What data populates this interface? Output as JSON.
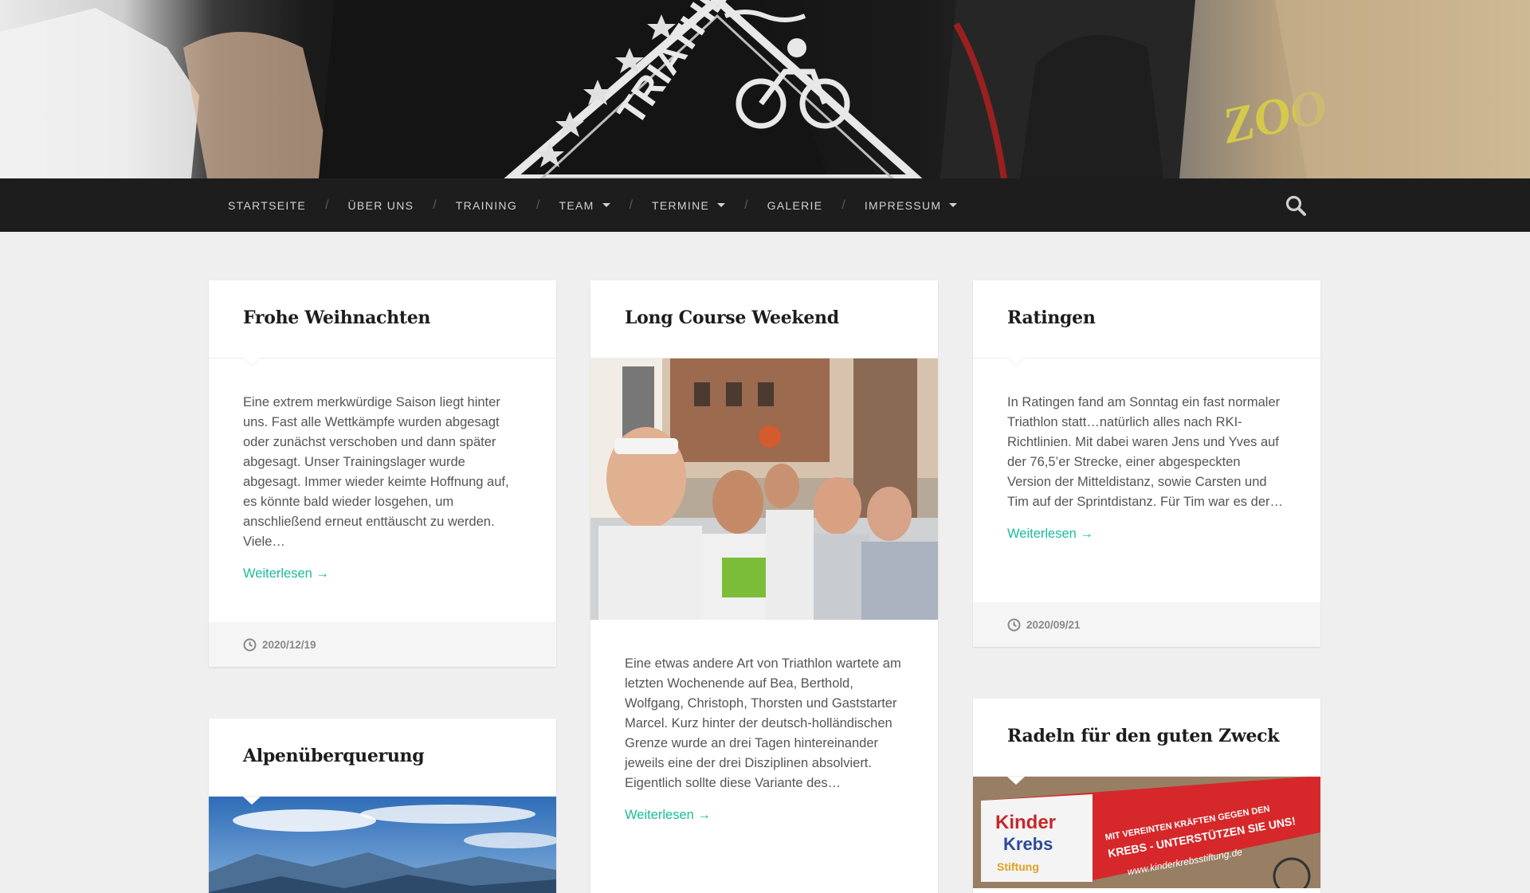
{
  "nav": {
    "items": [
      {
        "label": "Startseite",
        "dropdown": false
      },
      {
        "label": "Über uns",
        "dropdown": false
      },
      {
        "label": "Training",
        "dropdown": false
      },
      {
        "label": "Team",
        "dropdown": true
      },
      {
        "label": "Termine",
        "dropdown": true
      },
      {
        "label": "Galerie",
        "dropdown": false
      },
      {
        "label": "Impressum",
        "dropdown": true
      }
    ],
    "separator": "/",
    "search_icon": "search-icon"
  },
  "colors": {
    "accent": "#1abc9c",
    "navbar": "#1d1d1d",
    "page_bg": "#efefef"
  },
  "posts": [
    {
      "title": "Frohe Weihnachten",
      "excerpt": "Eine extrem merkwürdige Saison liegt hinter uns. Fast alle Wettkämpfe wurden abgesagt oder zunächst verschoben und dann später abgesagt. Unser Trainingslager wurde abgesagt. Immer wieder keimte Hoffnung auf, es könnte bald wieder losgehen, um anschließend erneut enttäuscht zu werden. Viele…",
      "more": "Weiterlesen →",
      "date": "2020/12/19"
    },
    {
      "title": "Long Course Weekend",
      "excerpt": "Eine etwas andere Art von Triathlon wartete am letzten Wochenende auf Bea, Berthold, Wolfgang, Christoph, Thorsten und Gaststarter Marcel. Kurz hinter der deutsch-holländischen Grenze wurde an drei Tagen hintereinander jeweils eine der drei Disziplinen absolviert. Eigentlich sollte diese Variante des…",
      "more": "Weiterlesen →"
    },
    {
      "title": "Ratingen",
      "excerpt": "In Ratingen fand am Sonntag ein fast normaler Triathlon statt…natürlich alles nach RKI-Richtlinien. Mit dabei waren Jens und Yves auf der 76,5’er Strecke, einer abgespeckten Version der Mitteldistanz, sowie Carsten und Tim auf der Sprintdistanz. Für Tim war es der…",
      "more": "Weiterlesen →",
      "date": "2020/09/21"
    },
    {
      "title": "Alpenüberquerung"
    },
    {
      "title": "Radeln für den guten Zweck",
      "banner_text": {
        "logo_line1": "Kinder",
        "logo_line2": "Krebs",
        "logo_line3": "Stiftung",
        "slogan1": "MIT VEREINTEN KRÄFTEN GEGEN DEN",
        "slogan2": "KREBS - UNTERSTÜTZEN SIE UNS!",
        "url": "www.kinderkrebsstiftung.de"
      }
    }
  ]
}
